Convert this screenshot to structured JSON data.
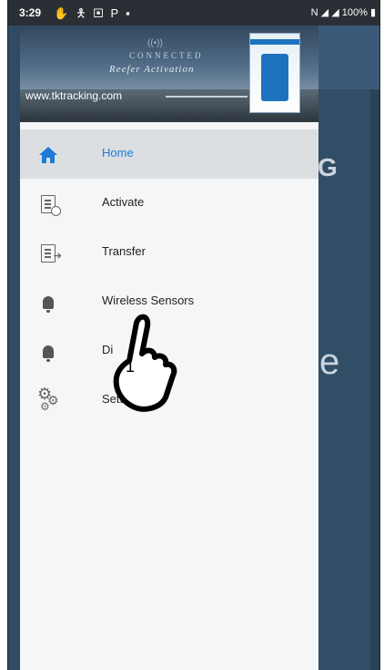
{
  "status_bar": {
    "time": "3:29",
    "battery": "100%",
    "left_icons": [
      "hand-icon",
      "person-icon",
      "tablet-icon",
      "p-icon",
      "image-icon"
    ],
    "right_icons": [
      "n-icon",
      "wifi-icon",
      "signal-icon",
      "battery-icon"
    ]
  },
  "header": {
    "brand_line1": "CONNECTED",
    "brand_line2": "Reefer Activation",
    "url": "www.tktracking.com"
  },
  "menu": {
    "items": [
      {
        "label": "Home",
        "icon": "home-icon"
      },
      {
        "label": "Activate",
        "icon": "document-check-icon"
      },
      {
        "label": "Transfer",
        "icon": "document-transfer-icon"
      },
      {
        "label": "Wireless Sensors",
        "icon": "bell-icon"
      },
      {
        "label": "Di",
        "icon": "bell-icon"
      },
      {
        "label": "Setti",
        "icon": "gears-icon"
      }
    ]
  },
  "background_text": {
    "g": "G",
    "e": "e"
  },
  "pointer_step": "1",
  "colors": {
    "accent": "#1e7ad6",
    "drawer_bg": "#f4f6f7",
    "active_bg": "#dcdfe1",
    "app_bg": "#324d66"
  }
}
